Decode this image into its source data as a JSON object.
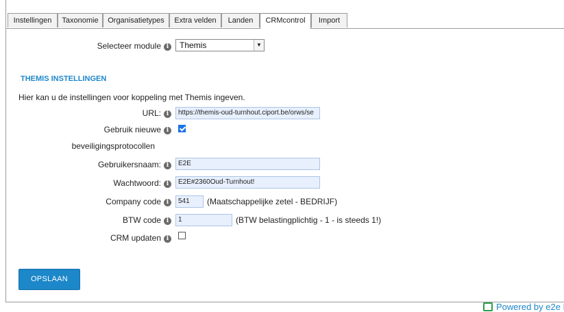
{
  "tabs": [
    "Instellingen",
    "Taxonomie",
    "Organisatietypes",
    "Extra velden",
    "Landen",
    "CRMcontrol",
    "Import"
  ],
  "active_tab": "CRMcontrol",
  "module": {
    "label": "Selecteer module",
    "value": "Themis"
  },
  "section_title": "THEMIS INSTELLINGEN",
  "intro": "Hier kan u de instellingen voor koppeling met Themis ingeven.",
  "fields": {
    "url": {
      "label": "URL:",
      "value": "https://themis-oud-turnhout.ciport.be/orws/se"
    },
    "protocol": {
      "label_line1": "Gebruik nieuwe",
      "label_line2": "beveiligingsprotocollen",
      "checked": true
    },
    "username": {
      "label": "Gebruikersnaam:",
      "value": "E2E"
    },
    "password": {
      "label": "Wachtwoord:",
      "value": "E2E#2360Oud-Turnhout!"
    },
    "company_code": {
      "label": "Company code",
      "value": "541",
      "note": "(Maatschappelijke zetel - BEDRIJF)"
    },
    "btw_code": {
      "label": "BTW code",
      "value": "1",
      "note": "(BTW belastingplichtig - 1 - is steeds 1!)"
    },
    "crm_update": {
      "label": "CRM updaten",
      "checked": false
    }
  },
  "save_label": "OPSLAAN",
  "powered_by": "Powered by e2e N",
  "colors": {
    "accent": "#1c87c9",
    "field_bg": "#e8f0fe",
    "checkbox": "#1a73e8"
  }
}
